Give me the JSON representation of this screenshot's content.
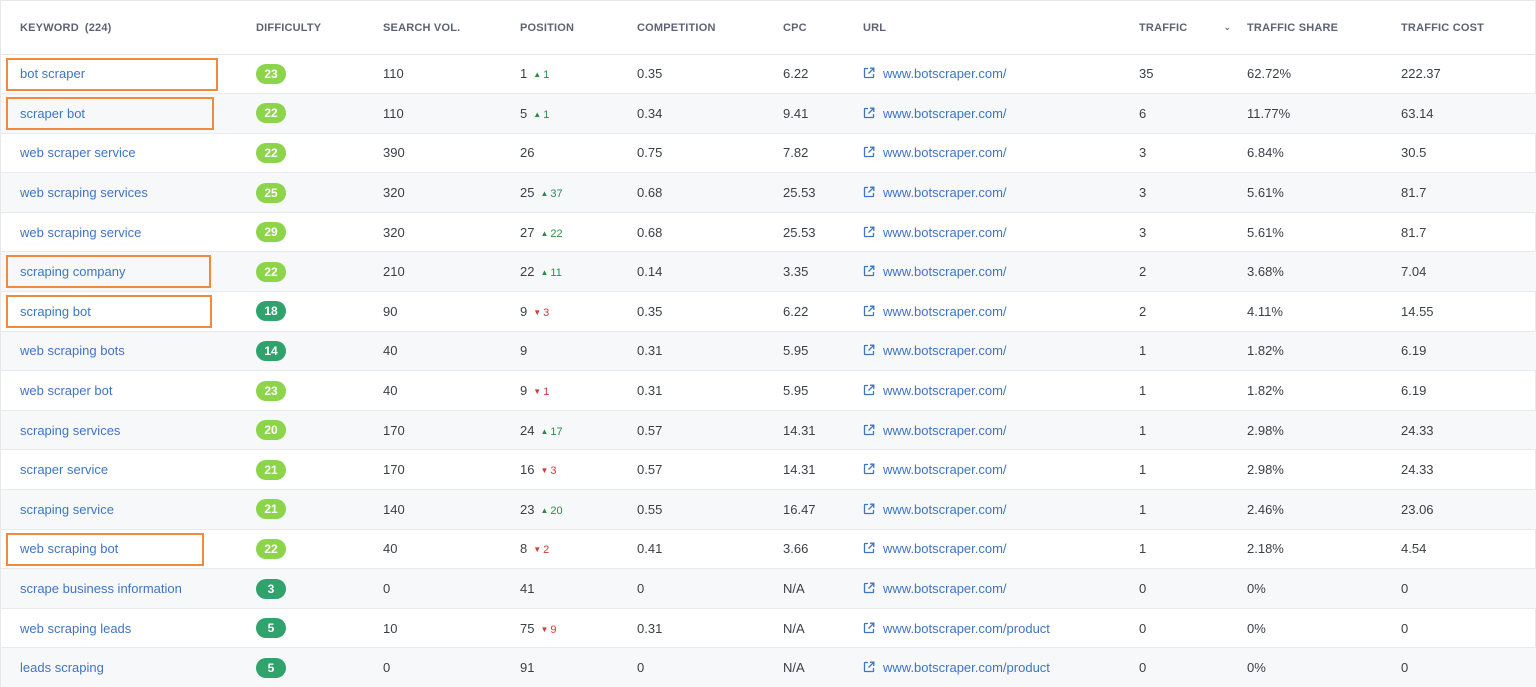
{
  "headers": {
    "keyword": "KEYWORD",
    "keyword_count": "(224)",
    "difficulty": "DIFFICULTY",
    "search_vol": "SEARCH VOL.",
    "position": "POSITION",
    "competition": "COMPETITION",
    "cpc": "CPC",
    "url": "URL",
    "traffic": "TRAFFIC",
    "traffic_share": "TRAFFIC SHARE",
    "traffic_cost": "TRAFFIC COST"
  },
  "colors": {
    "light_green": "#8cd44a",
    "dark_green": "#2fa36b",
    "highlight": "#f08a3c",
    "link": "#3f74c4"
  },
  "rows": [
    {
      "keyword": "bot scraper",
      "difficulty": "23",
      "diff_level": "light",
      "search_vol": "110",
      "position": "1",
      "delta": "1",
      "delta_dir": "up",
      "competition": "0.35",
      "cpc": "6.22",
      "url": "www.botscraper.com/",
      "traffic": "35",
      "traffic_share": "62.72%",
      "traffic_cost": "222.37",
      "highlighted": true
    },
    {
      "keyword": "scraper bot",
      "difficulty": "22",
      "diff_level": "light",
      "search_vol": "110",
      "position": "5",
      "delta": "1",
      "delta_dir": "up",
      "competition": "0.34",
      "cpc": "9.41",
      "url": "www.botscraper.com/",
      "traffic": "6",
      "traffic_share": "11.77%",
      "traffic_cost": "63.14",
      "highlighted": true
    },
    {
      "keyword": "web scraper service",
      "difficulty": "22",
      "diff_level": "light",
      "search_vol": "390",
      "position": "26",
      "delta": "",
      "delta_dir": "",
      "competition": "0.75",
      "cpc": "7.82",
      "url": "www.botscraper.com/",
      "traffic": "3",
      "traffic_share": "6.84%",
      "traffic_cost": "30.5",
      "highlighted": false
    },
    {
      "keyword": "web scraping services",
      "difficulty": "25",
      "diff_level": "light",
      "search_vol": "320",
      "position": "25",
      "delta": "37",
      "delta_dir": "up",
      "competition": "0.68",
      "cpc": "25.53",
      "url": "www.botscraper.com/",
      "traffic": "3",
      "traffic_share": "5.61%",
      "traffic_cost": "81.7",
      "highlighted": false
    },
    {
      "keyword": "web scraping service",
      "difficulty": "29",
      "diff_level": "light",
      "search_vol": "320",
      "position": "27",
      "delta": "22",
      "delta_dir": "up",
      "competition": "0.68",
      "cpc": "25.53",
      "url": "www.botscraper.com/",
      "traffic": "3",
      "traffic_share": "5.61%",
      "traffic_cost": "81.7",
      "highlighted": false
    },
    {
      "keyword": "scraping company",
      "difficulty": "22",
      "diff_level": "light",
      "search_vol": "210",
      "position": "22",
      "delta": "11",
      "delta_dir": "up",
      "competition": "0.14",
      "cpc": "3.35",
      "url": "www.botscraper.com/",
      "traffic": "2",
      "traffic_share": "3.68%",
      "traffic_cost": "7.04",
      "highlighted": true
    },
    {
      "keyword": "scraping bot",
      "difficulty": "18",
      "diff_level": "dark",
      "search_vol": "90",
      "position": "9",
      "delta": "3",
      "delta_dir": "down",
      "competition": "0.35",
      "cpc": "6.22",
      "url": "www.botscraper.com/",
      "traffic": "2",
      "traffic_share": "4.11%",
      "traffic_cost": "14.55",
      "highlighted": true
    },
    {
      "keyword": "web scraping bots",
      "difficulty": "14",
      "diff_level": "dark",
      "search_vol": "40",
      "position": "9",
      "delta": "",
      "delta_dir": "",
      "competition": "0.31",
      "cpc": "5.95",
      "url": "www.botscraper.com/",
      "traffic": "1",
      "traffic_share": "1.82%",
      "traffic_cost": "6.19",
      "highlighted": false
    },
    {
      "keyword": "web scraper bot",
      "difficulty": "23",
      "diff_level": "light",
      "search_vol": "40",
      "position": "9",
      "delta": "1",
      "delta_dir": "down",
      "competition": "0.31",
      "cpc": "5.95",
      "url": "www.botscraper.com/",
      "traffic": "1",
      "traffic_share": "1.82%",
      "traffic_cost": "6.19",
      "highlighted": false
    },
    {
      "keyword": "scraping services",
      "difficulty": "20",
      "diff_level": "light",
      "search_vol": "170",
      "position": "24",
      "delta": "17",
      "delta_dir": "up",
      "competition": "0.57",
      "cpc": "14.31",
      "url": "www.botscraper.com/",
      "traffic": "1",
      "traffic_share": "2.98%",
      "traffic_cost": "24.33",
      "highlighted": false
    },
    {
      "keyword": "scraper service",
      "difficulty": "21",
      "diff_level": "light",
      "search_vol": "170",
      "position": "16",
      "delta": "3",
      "delta_dir": "down",
      "competition": "0.57",
      "cpc": "14.31",
      "url": "www.botscraper.com/",
      "traffic": "1",
      "traffic_share": "2.98%",
      "traffic_cost": "24.33",
      "highlighted": false
    },
    {
      "keyword": "scraping service",
      "difficulty": "21",
      "diff_level": "light",
      "search_vol": "140",
      "position": "23",
      "delta": "20",
      "delta_dir": "up",
      "competition": "0.55",
      "cpc": "16.47",
      "url": "www.botscraper.com/",
      "traffic": "1",
      "traffic_share": "2.46%",
      "traffic_cost": "23.06",
      "highlighted": false
    },
    {
      "keyword": "web scraping bot",
      "difficulty": "22",
      "diff_level": "light",
      "search_vol": "40",
      "position": "8",
      "delta": "2",
      "delta_dir": "down",
      "competition": "0.41",
      "cpc": "3.66",
      "url": "www.botscraper.com/",
      "traffic": "1",
      "traffic_share": "2.18%",
      "traffic_cost": "4.54",
      "highlighted": true
    },
    {
      "keyword": "scrape business information",
      "difficulty": "3",
      "diff_level": "dark",
      "search_vol": "0",
      "position": "41",
      "delta": "",
      "delta_dir": "",
      "competition": "0",
      "cpc": "N/A",
      "url": "www.botscraper.com/",
      "traffic": "0",
      "traffic_share": "0%",
      "traffic_cost": "0",
      "highlighted": false
    },
    {
      "keyword": "web scraping leads",
      "difficulty": "5",
      "diff_level": "dark",
      "search_vol": "10",
      "position": "75",
      "delta": "9",
      "delta_dir": "down",
      "competition": "0.31",
      "cpc": "N/A",
      "url": "www.botscraper.com/product",
      "traffic": "0",
      "traffic_share": "0%",
      "traffic_cost": "0",
      "highlighted": false
    },
    {
      "keyword": "leads scraping",
      "difficulty": "5",
      "diff_level": "dark",
      "search_vol": "0",
      "position": "91",
      "delta": "",
      "delta_dir": "",
      "competition": "0",
      "cpc": "N/A",
      "url": "www.botscraper.com/product",
      "traffic": "0",
      "traffic_share": "0%",
      "traffic_cost": "0",
      "highlighted": false
    }
  ]
}
